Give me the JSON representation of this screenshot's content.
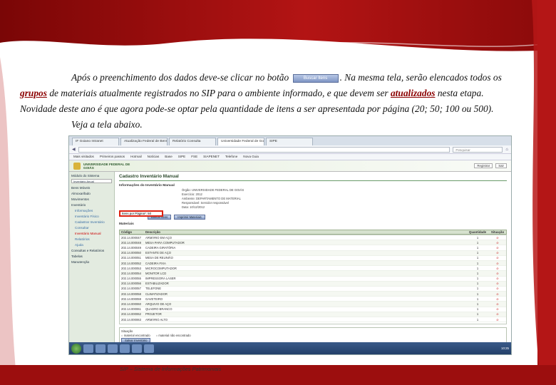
{
  "paragraph": {
    "line1_pre": "Após o preenchimento dos dados deve-se clicar no botão",
    "button_label": "Buscar Itens",
    "line1_post": ". Na mesma tela, serão elencados todos os",
    "line2_word1": "grupos",
    "line2_mid": " de materiais atualmente registrados no SIP para o ambiente informado, e que devem ser ",
    "line2_word2": "atualizados",
    "line2_end": " nesta etapa.",
    "line3": "Novidade deste ano é que agora pode-se optar pela quantidade de itens a ser apresentada por página (20; 50; 100 ou 500).",
    "line4": "Veja a tela abaixo."
  },
  "screenshot": {
    "tabs": [
      "IF Goiano Intranet",
      "Atualização Federal de Bens",
      "Relatório Consulta",
      "Universidade Federal de Goiás",
      "SIPE"
    ],
    "url": "",
    "search_placeholder": "Pesquisar",
    "bookmarks": [
      "Mais visitados",
      "Primeiros passos",
      "Hotmail",
      "Notícias",
      "Base",
      "SIPE",
      "FSE",
      "SIAPENET",
      "Telefone",
      "Nova Guia"
    ],
    "app_name": "UNIVERSIDADE FEDERAL DE GOIÁS",
    "header_links": [
      "Registrar",
      "Sair"
    ],
    "sidebar": {
      "label": "Módulo do Sistema",
      "field": "Inventário Anual",
      "items": [
        "Bens Móveis",
        "Almoxarifado",
        "Movimentos",
        "Inventário",
        "Informações",
        "Inventário Físico",
        "Cadastrar Inventário",
        "Consultar",
        "Inventário Manual",
        "Relatórios",
        "Ajuda",
        "Consultas e Relatórios",
        "Tabelas",
        "Manutenção"
      ]
    },
    "page_title": "Cadastro Inventário Manual",
    "section_info": "Informações do Inventário Manual",
    "form_rows": [
      "Órgão: UNIVERSIDADE FEDERAL DE GOIÁS",
      "Exercício: 2012",
      "Ambiente: DEPARTAMENTO DE MATERIAL",
      "Responsável: Servidor responsável",
      "Data: 10/12/2012"
    ],
    "qty_label": "Itens por Página*: 50",
    "btn_search": "Buscar Itens",
    "btn_print": "Imprimir Materiais",
    "section_materials": "Materiais",
    "table": {
      "headers": [
        "Código",
        "Descrição",
        "Quantidade",
        "Situação"
      ],
      "rows": [
        [
          "202.14.000047",
          "ARMÁRIO EM AÇO",
          "1",
          "⊘"
        ],
        [
          "202.14.000048",
          "MESA PARA COMPUTADOR",
          "1",
          "⊘"
        ],
        [
          "202.14.000049",
          "CADEIRA GIRATÓRIA",
          "1",
          "⊘"
        ],
        [
          "202.14.000050",
          "ESTANTE DE AÇO",
          "1",
          "⊘"
        ],
        [
          "202.14.000051",
          "MESA DE REUNIÃO",
          "1",
          "⊘"
        ],
        [
          "202.14.000052",
          "CADEIRA FIXA",
          "1",
          "⊘"
        ],
        [
          "202.14.000053",
          "MICROCOMPUTADOR",
          "1",
          "⊘"
        ],
        [
          "202.14.000054",
          "MONITOR LCD",
          "1",
          "⊘"
        ],
        [
          "202.14.000055",
          "IMPRESSORA LASER",
          "1",
          "⊘"
        ],
        [
          "202.14.000056",
          "ESTABILIZADOR",
          "1",
          "⊘"
        ],
        [
          "202.14.000057",
          "TELEFONE",
          "1",
          "⊘"
        ],
        [
          "202.14.000058",
          "CLIMATIZADOR",
          "1",
          "⊘"
        ],
        [
          "202.14.000059",
          "GAVETEIRO",
          "1",
          "⊘"
        ],
        [
          "202.14.000060",
          "ARQUIVO DE AÇO",
          "1",
          "⊘"
        ],
        [
          "202.14.000061",
          "QUADRO BRANCO",
          "1",
          "⊘"
        ],
        [
          "202.14.000062",
          "PROJETOR",
          "1",
          "⊘"
        ],
        [
          "202.14.000063",
          "ARMÁRIO ALTO",
          "1",
          "⊘"
        ]
      ]
    },
    "footer_label": "Situação",
    "footer_options": [
      "material encontrado",
      "material não encontrado"
    ],
    "footer_button": "Salvar Inventário",
    "clock": "10:25"
  },
  "caption": "SIP – Sistema de Informações Patrimoniais",
  "colors": {
    "brand_red": "#9c0e0e",
    "accent_green": "#2d4a2d"
  }
}
